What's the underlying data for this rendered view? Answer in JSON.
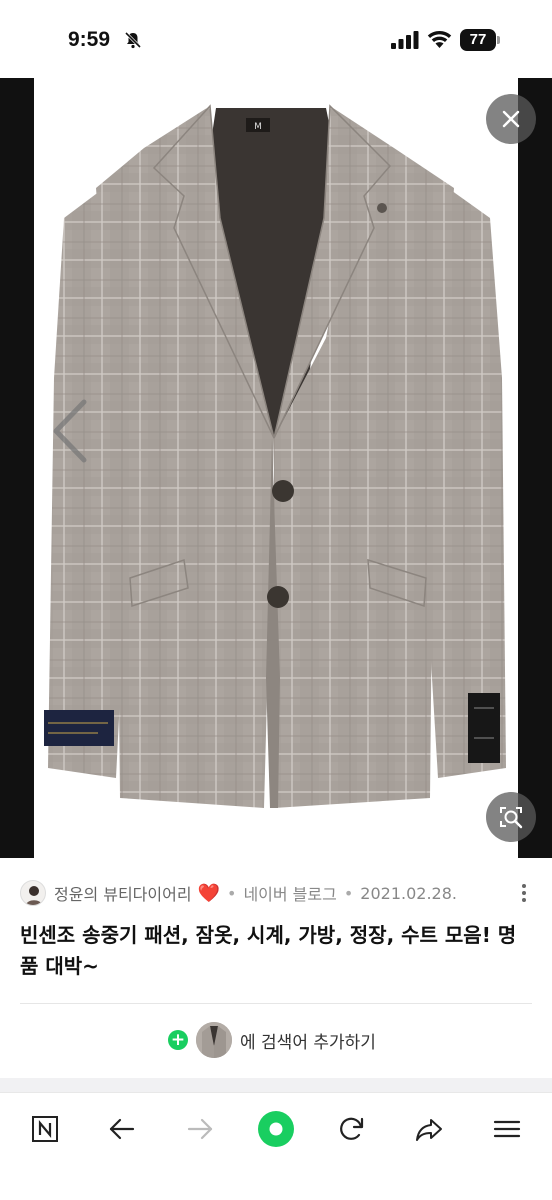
{
  "status_bar": {
    "time": "9:59",
    "battery": "77",
    "icons": [
      "bell-slash-icon",
      "cellular-signal-icon",
      "wifi-icon",
      "battery-icon"
    ]
  },
  "viewer": {
    "icons": [
      "close-icon",
      "chevron-left-icon",
      "image-search-lens-icon"
    ],
    "photo_colors": {
      "jacket": "#a8a19b",
      "lining": "#3a3532",
      "check_line": "#cfc8c2",
      "button": "#3b3631",
      "backdrop": "#111111"
    }
  },
  "source": {
    "blog_name": "정윤의 뷰티다이어리",
    "heart": "❤️",
    "separator": "•",
    "platform": "네이버 블로그",
    "date": "2021.02.28.",
    "more_icon": "more-vertical-icon"
  },
  "title": "빈센조 송중기 패션, 잠옷, 시계, 가방, 정장, 수트 모음! 명품 대박~",
  "add_keyword": {
    "plus": "+",
    "label": "에 검색어 추가하기",
    "accent": "#19ce60"
  },
  "toolbar": {
    "items": [
      "naver-home-icon",
      "back-arrow-icon",
      "forward-arrow-icon",
      "green-dot-icon",
      "refresh-icon",
      "share-icon",
      "menu-icon"
    ]
  }
}
